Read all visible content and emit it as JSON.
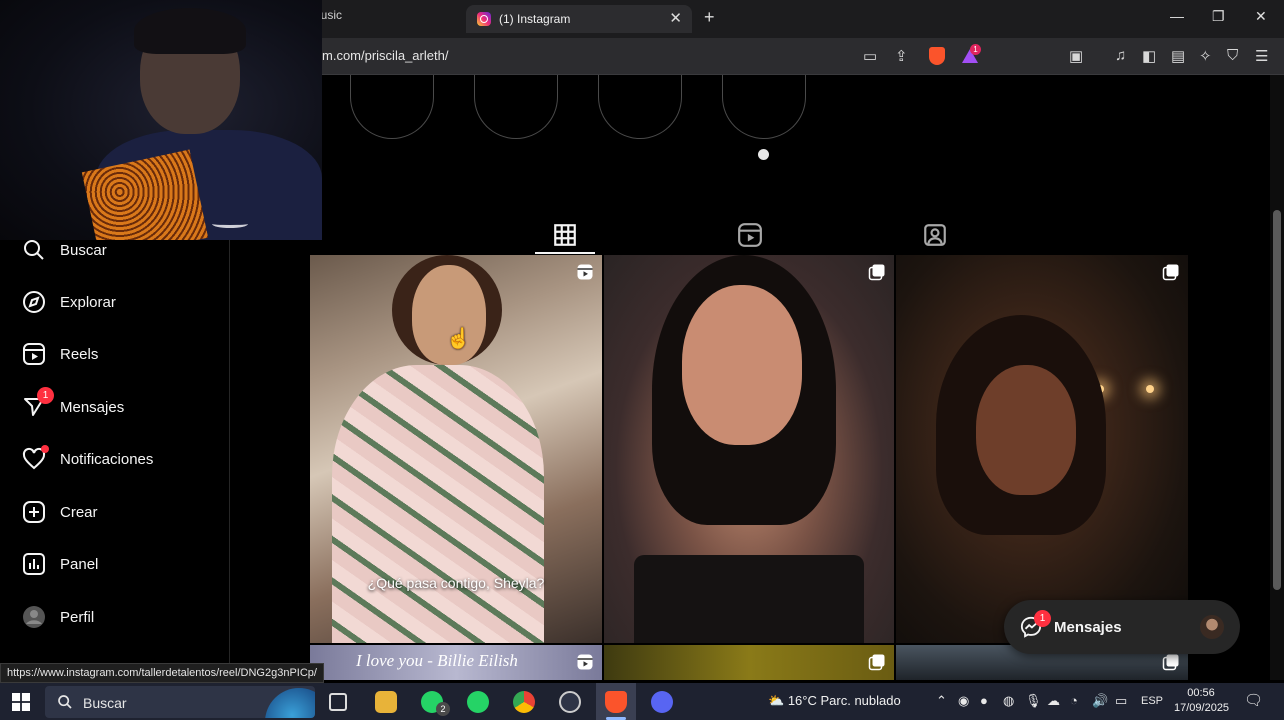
{
  "browser": {
    "prev_tab_title": "lusic",
    "active_tab_title": "(1) Instagram",
    "new_tab_glyph": "+",
    "url": "m.com/priscila_arleth/",
    "rewards_badge": "1",
    "accent": "#fb542b"
  },
  "sidebar": {
    "items": [
      {
        "label": "Buscar",
        "icon": "search-icon"
      },
      {
        "label": "Explorar",
        "icon": "compass-icon"
      },
      {
        "label": "Reels",
        "icon": "reels-icon"
      },
      {
        "label": "Mensajes",
        "icon": "messenger-icon",
        "badge": "1"
      },
      {
        "label": "Notificaciones",
        "icon": "heart-icon",
        "dot": true
      },
      {
        "label": "Crear",
        "icon": "plus-square-icon"
      },
      {
        "label": "Panel",
        "icon": "chart-icon"
      },
      {
        "label": "Perfil",
        "icon": "avatar"
      }
    ]
  },
  "profile": {
    "tabs": [
      {
        "name": "posts",
        "icon": "grid-icon",
        "active": true
      },
      {
        "name": "reels",
        "icon": "reels-icon",
        "active": false
      },
      {
        "name": "tagged",
        "icon": "tagged-icon",
        "active": false
      }
    ],
    "posts": [
      {
        "type": "reel",
        "caption": "¿Qué pasa contigo, Sheyla?"
      },
      {
        "type": "carousel",
        "caption": ""
      },
      {
        "type": "carousel",
        "caption": ""
      },
      {
        "type": "reel",
        "caption": "I love you - Billie Eilish"
      },
      {
        "type": "carousel",
        "caption": ""
      },
      {
        "type": "carousel",
        "caption": ""
      }
    ]
  },
  "floating_messages": {
    "label": "Mensajes",
    "badge": "1"
  },
  "status_link": "https://www.instagram.com/tallerdetalentos/reel/DNG2g3nPICp/",
  "taskbar": {
    "search_label": "Buscar",
    "whatsapp_badge": "2",
    "weather_temp": "16°C",
    "weather_text": "Parc. nublado",
    "language": "ESP",
    "time": "00:56",
    "date": "17/09/2025"
  }
}
